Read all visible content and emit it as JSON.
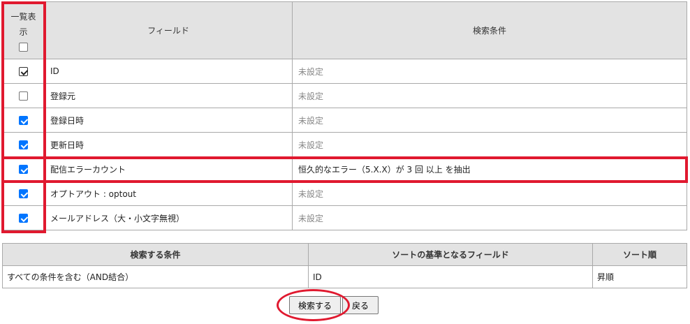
{
  "field_table": {
    "headers": {
      "list_display_line1": "一覧表",
      "list_display_line2": "示",
      "field": "フィールド",
      "condition": "検索条件"
    },
    "header_checkbox_checked": false,
    "rows": [
      {
        "field": "ID",
        "condition": "未設定",
        "checked": true,
        "condition_set": false
      },
      {
        "field": "登録元",
        "condition": "未設定",
        "checked": false,
        "condition_set": false
      },
      {
        "field": "登録日時",
        "condition": "未設定",
        "checked": true,
        "condition_set": false
      },
      {
        "field": "更新日時",
        "condition": "未設定",
        "checked": true,
        "condition_set": false
      },
      {
        "field": "配信エラーカウント",
        "condition": "恒久的なエラー（5.X.X）が 3 回 以上 を抽出",
        "checked": true,
        "condition_set": true
      },
      {
        "field": "オプトアウト : optout",
        "condition": "未設定",
        "checked": true,
        "condition_set": false
      },
      {
        "field": "メールアドレス（大・小文字無視）",
        "condition": "未設定",
        "checked": true,
        "condition_set": false
      }
    ]
  },
  "search_table": {
    "headers": {
      "condition_mode": "検索する条件",
      "sort_field": "ソートの基準となるフィールド",
      "sort_order": "ソート順"
    },
    "values": {
      "condition_mode": "すべての条件を含む（AND結合）",
      "sort_field": "ID",
      "sort_order": "昇順"
    }
  },
  "buttons": {
    "search": "検索する",
    "back": "戻る"
  },
  "colors": {
    "highlight": "#e0192f",
    "checkbox_checked": "#0075ff",
    "header_bg": "#e3e3e3",
    "unset_text": "#888888"
  }
}
